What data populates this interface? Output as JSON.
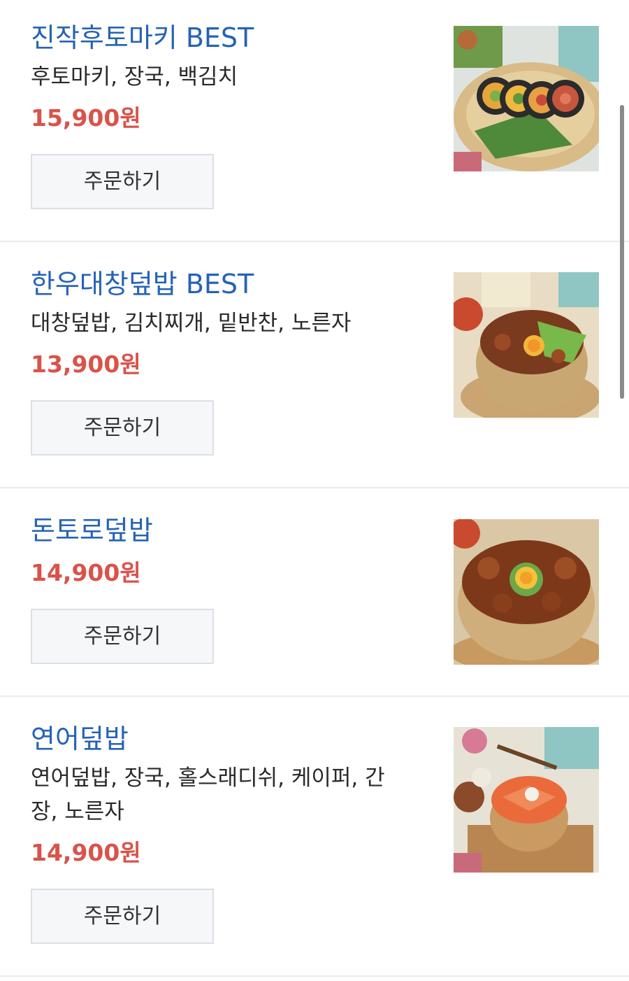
{
  "menu": {
    "items": [
      {
        "title": "진작후토마키 BEST",
        "description": "후토마키, 장국, 백김치",
        "price": "15,900원",
        "order_label": "주문하기",
        "photo": "futomaki-roll-photo"
      },
      {
        "title": "한우대창덮밥 BEST",
        "description": "대창덮밥, 김치찌개, 밑반찬, 노른자",
        "price": "13,900원",
        "order_label": "주문하기",
        "photo": "beef-intestine-rice-bowl-photo"
      },
      {
        "title": "돈토로덮밥",
        "description": "",
        "price": "14,900원",
        "order_label": "주문하기",
        "photo": "pork-jowl-rice-bowl-photo"
      },
      {
        "title": "연어덮밥",
        "description": "연어덮밥, 장국, 홀스래디쉬, 케이퍼, 간장, 노른자",
        "price": "14,900원",
        "order_label": "주문하기",
        "photo": "salmon-rice-bowl-photo"
      }
    ]
  },
  "colors": {
    "title": "#2563b5",
    "price": "#d9534a",
    "button_bg": "#f6f7f9",
    "divider": "#ebebeb"
  }
}
